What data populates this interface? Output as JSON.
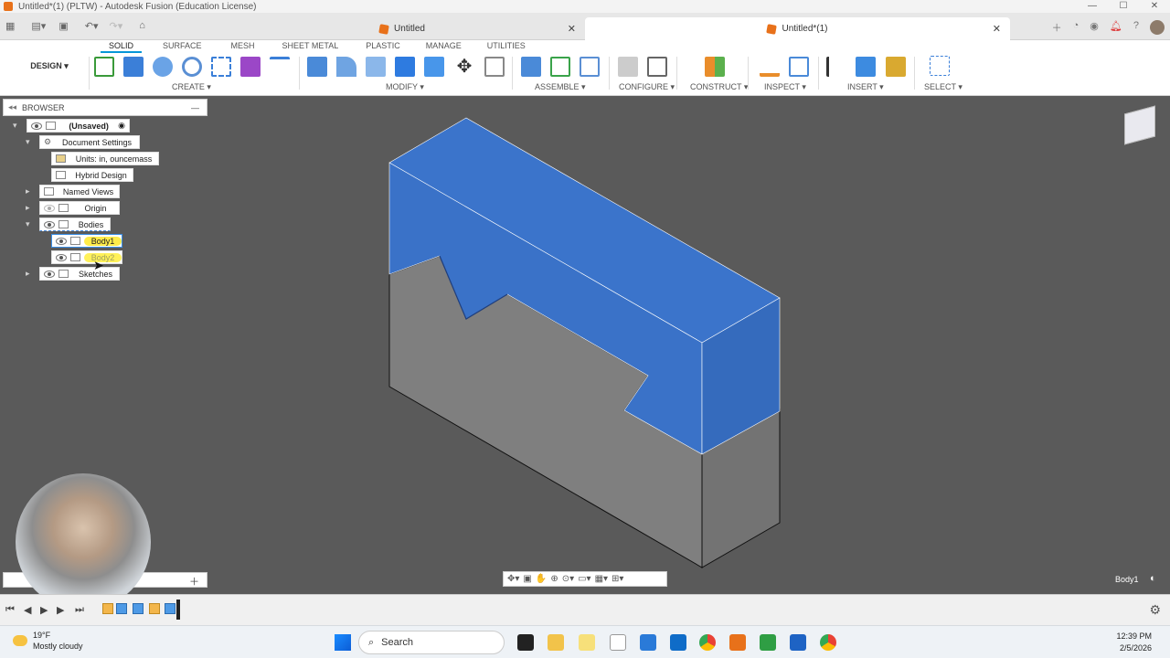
{
  "window": {
    "title": "Untitled*(1) (PLTW) - Autodesk Fusion (Education License)",
    "controls": [
      "—",
      "☐",
      "✕"
    ]
  },
  "tabs": [
    {
      "label": "Untitled",
      "active": false
    },
    {
      "label": "Untitled*(1)",
      "active": true
    }
  ],
  "ribbon": {
    "workspace": "DESIGN ▾",
    "tabs": [
      "SOLID",
      "SURFACE",
      "MESH",
      "SHEET METAL",
      "PLASTIC",
      "MANAGE",
      "UTILITIES"
    ],
    "active_tab": "SOLID",
    "groups": [
      "CREATE ▾",
      "MODIFY ▾",
      "ASSEMBLE ▾",
      "CONFIGURE ▾",
      "CONSTRUCT ▾",
      "INSPECT ▾",
      "INSERT ▾",
      "SELECT ▾"
    ],
    "accent": "#0696d7"
  },
  "browser": {
    "header": "BROWSER",
    "nodes": [
      {
        "label": "(Unsaved)"
      },
      {
        "label": "Document Settings"
      },
      {
        "label": "Units: in, ouncemass"
      },
      {
        "label": "Hybrid Design"
      },
      {
        "label": "Named Views"
      },
      {
        "label": "Origin"
      },
      {
        "label": "Bodies"
      },
      {
        "label": "Body1"
      },
      {
        "label": "Body2"
      },
      {
        "label": "Sketches"
      }
    ]
  },
  "viewport": {
    "selected_body_color": "#3a72c8",
    "body_color": "#808080",
    "status_label": "Body1"
  },
  "navbar": {
    "icons": [
      "orbit-icon",
      "pan-icon",
      "hand-icon",
      "zoom-icon",
      "zoom-window-icon",
      "display-icon",
      "grid-icon",
      "viewports-icon"
    ]
  },
  "taskbar": {
    "temperature": "19°F",
    "weather": "Mostly cloudy",
    "search_placeholder": "Search",
    "time": "12:39 PM",
    "date": "2/5/2026"
  }
}
